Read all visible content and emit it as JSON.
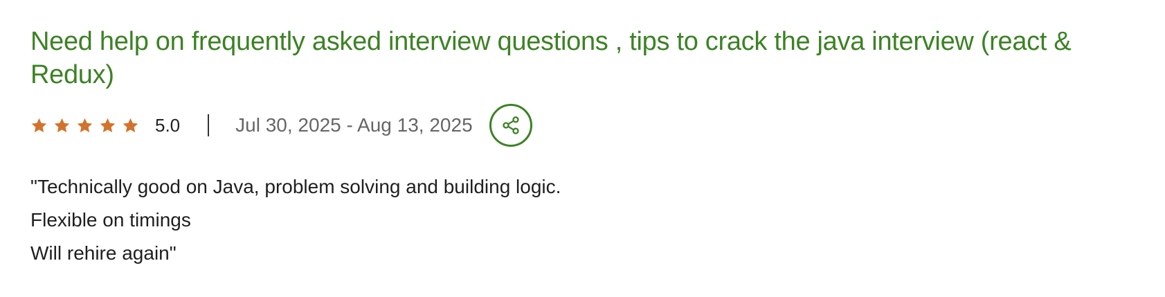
{
  "review": {
    "title": "Need help on frequently asked interview questions , tips to crack the java interview (react & Redux)",
    "rating_value": "5.0",
    "rating_stars": 5,
    "date_range": "Jul 30, 2025 - Aug 13, 2025",
    "share_icon": "share-icon",
    "body_lines": [
      "\"Technically good on Java, problem solving and building logic.",
      "Flexible on timings",
      "Will rehire again\""
    ]
  },
  "colors": {
    "title_green": "#3c8224",
    "star_orange": "#d4722a",
    "date_gray": "#666666",
    "text_dark": "#1f1f1f"
  }
}
